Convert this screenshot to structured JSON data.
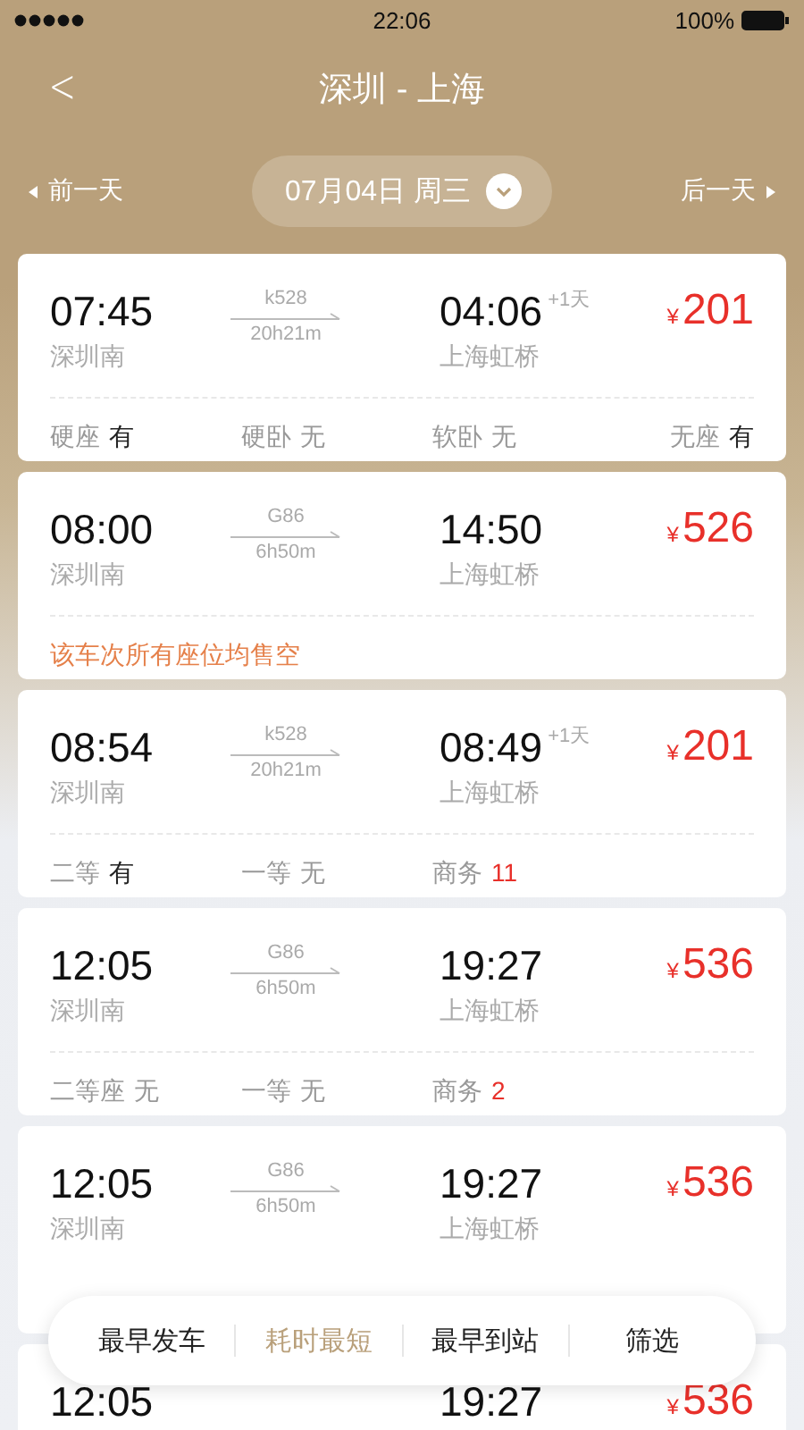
{
  "status_bar": {
    "time": "22:06",
    "battery": "100%"
  },
  "header": {
    "back": "<",
    "title": "深圳 - 上海"
  },
  "date_bar": {
    "prev": "前一天",
    "date": "07月04日 周三",
    "next": "后一天"
  },
  "trains": [
    {
      "depart": "07:45",
      "from": "深圳南",
      "train": "k528",
      "duration": "20h21m",
      "arrive": "04:06",
      "next_day": "+1天",
      "to": "上海虹桥",
      "currency": "¥",
      "price": "201",
      "seats": [
        {
          "label": "硬座",
          "value": "有",
          "kind": "available"
        },
        {
          "label": "硬卧",
          "value": "无",
          "kind": "none"
        },
        {
          "label": "软卧",
          "value": "无",
          "kind": "none"
        },
        {
          "label": "无座",
          "value": "有",
          "kind": "available"
        }
      ]
    },
    {
      "depart": "08:00",
      "from": "深圳南",
      "train": "G86",
      "duration": "6h50m",
      "arrive": "14:50",
      "to": "上海虹桥",
      "currency": "¥",
      "price": "526",
      "notice": "该车次所有座位均售空"
    },
    {
      "depart": "08:54",
      "from": "深圳南",
      "train": "k528",
      "duration": "20h21m",
      "arrive": "08:49",
      "next_day": "+1天",
      "to": "上海虹桥",
      "currency": "¥",
      "price": "201",
      "seats": [
        {
          "label": "二等",
          "value": "有",
          "kind": "available"
        },
        {
          "label": "一等",
          "value": "无",
          "kind": "none"
        },
        {
          "label": "商务",
          "value": "11",
          "kind": "count"
        }
      ]
    },
    {
      "depart": "12:05",
      "from": "深圳南",
      "train": "G86",
      "duration": "6h50m",
      "arrive": "19:27",
      "to": "上海虹桥",
      "currency": "¥",
      "price": "536",
      "seats": [
        {
          "label": "二等座",
          "value": "无",
          "kind": "none"
        },
        {
          "label": "一等",
          "value": "无",
          "kind": "none"
        },
        {
          "label": "商务",
          "value": "2",
          "kind": "count"
        }
      ]
    },
    {
      "depart": "12:05",
      "from": "深圳南",
      "train": "G86",
      "duration": "6h50m",
      "arrive": "19:27",
      "to": "上海虹桥",
      "currency": "¥",
      "price": "536"
    },
    {
      "depart": "12:05",
      "arrive": "19:27",
      "currency": "¥",
      "price": "536"
    }
  ],
  "sort_bar": [
    {
      "label": "最早发车",
      "selected": false
    },
    {
      "label": "耗时最短",
      "selected": true
    },
    {
      "label": "最早到站",
      "selected": false
    },
    {
      "label": "筛选",
      "selected": false
    }
  ]
}
